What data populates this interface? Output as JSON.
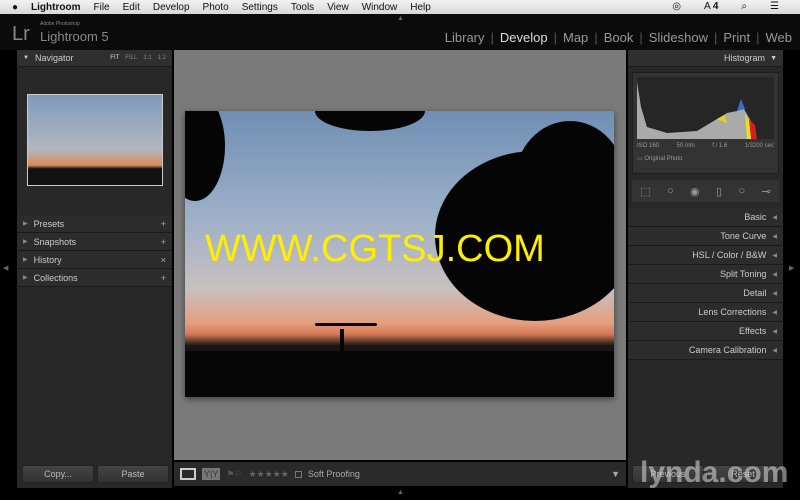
{
  "menubar": {
    "app": "Lightroom",
    "items": [
      "File",
      "Edit",
      "Develop",
      "Photo",
      "Settings",
      "Tools",
      "View",
      "Window",
      "Help"
    ],
    "adobe_count": "4"
  },
  "header": {
    "logo": "Lr",
    "brand_small": "Adobe Photoshop",
    "brand": "Lightroom 5",
    "modules": [
      "Library",
      "Develop",
      "Map",
      "Book",
      "Slideshow",
      "Print",
      "Web"
    ],
    "active": "Develop"
  },
  "left": {
    "navigator": {
      "title": "Navigator",
      "zoom": [
        "FIT",
        "FILL",
        "1:1",
        "1:2"
      ]
    },
    "sections": [
      {
        "label": "Presets",
        "action": "+"
      },
      {
        "label": "Snapshots",
        "action": "+"
      },
      {
        "label": "History",
        "action": "×"
      },
      {
        "label": "Collections",
        "action": "+"
      }
    ],
    "copy": "Copy...",
    "paste": "Paste"
  },
  "watermark": "WWW.CGTSJ.COM",
  "toolbar": {
    "soft_proofing": "Soft Proofing",
    "stars": "★★★★★",
    "compare": "Y|Y"
  },
  "right": {
    "histogram": {
      "title": "Histogram",
      "iso": "ISO 160",
      "focal": "50 mm",
      "aperture": "f / 1.6",
      "shutter": "1/3200 sec",
      "original": "Original Photo"
    },
    "sections": [
      "Basic",
      "Tone Curve",
      "HSL / Color / B&W",
      "Split Toning",
      "Detail",
      "Lens Corrections",
      "Effects",
      "Camera Calibration"
    ],
    "previous": "Previous",
    "reset": "Reset"
  },
  "lynda": "lynda.com"
}
